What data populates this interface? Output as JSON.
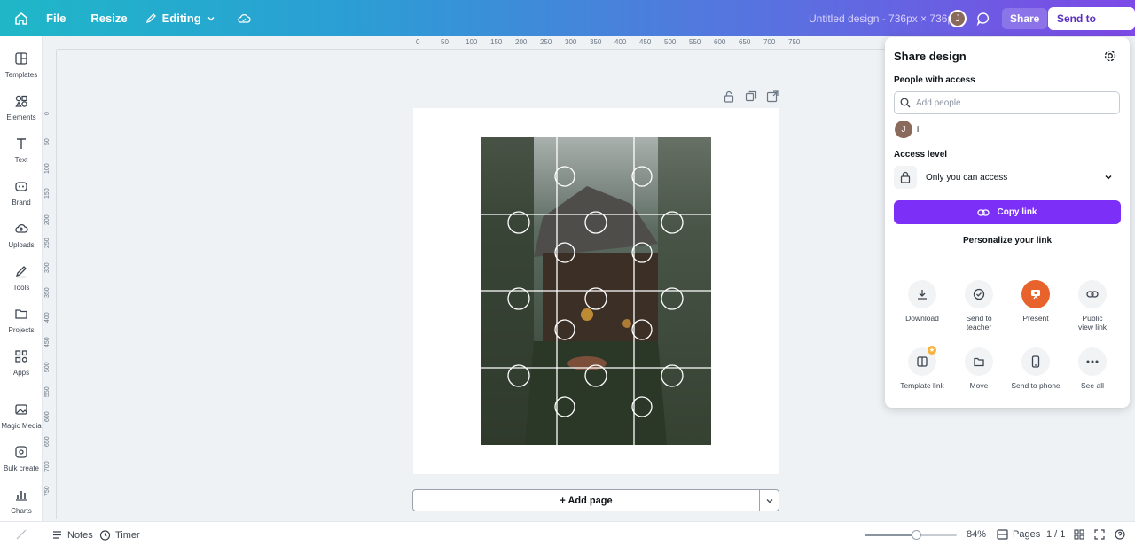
{
  "topbar": {
    "file": "File",
    "resize": "Resize",
    "editing": "Editing",
    "title": "Untitled design - 736px × 736px",
    "avatar": "J",
    "share": "Share",
    "send_to_teacher": "Send to teacher"
  },
  "sidebar": {
    "items": [
      {
        "label": "Templates",
        "icon": "templates-icon"
      },
      {
        "label": "Elements",
        "icon": "elements-icon"
      },
      {
        "label": "Text",
        "icon": "text-icon"
      },
      {
        "label": "Brand",
        "icon": "brand-icon"
      },
      {
        "label": "Uploads",
        "icon": "uploads-icon"
      },
      {
        "label": "Tools",
        "icon": "tools-icon"
      },
      {
        "label": "Projects",
        "icon": "projects-icon"
      },
      {
        "label": "Apps",
        "icon": "apps-icon"
      },
      {
        "label": "Magic Media",
        "icon": "magic-media-icon"
      },
      {
        "label": "Bulk create",
        "icon": "bulk-create-icon"
      },
      {
        "label": "Charts",
        "icon": "charts-icon"
      }
    ]
  },
  "ruler": {
    "horizontal": [
      "0",
      "50",
      "100",
      "150",
      "200",
      "250",
      "300",
      "350",
      "400",
      "450",
      "500",
      "550",
      "600",
      "650",
      "700",
      "750"
    ],
    "vertical": [
      "0",
      "50",
      "100",
      "150",
      "200",
      "250",
      "300",
      "350",
      "400",
      "450",
      "500",
      "550",
      "600",
      "650",
      "700",
      "750"
    ]
  },
  "canvas": {
    "add_page": "+ Add page"
  },
  "bottombar": {
    "notes": "Notes",
    "timer": "Timer",
    "zoom": "84%",
    "zoom_level": 0.84,
    "pages": "Pages",
    "page_count": "1 / 1"
  },
  "share_panel": {
    "title": "Share design",
    "people_label": "People with access",
    "add_people_placeholder": "Add people",
    "avatar": "J",
    "access_label": "Access level",
    "access_value": "Only you can access",
    "copy_link": "Copy link",
    "personalize": "Personalize your link",
    "options": [
      {
        "label": "Download",
        "icon": "download-icon"
      },
      {
        "label": "Send to teacher",
        "icon": "check-circle-icon"
      },
      {
        "label": "Present",
        "icon": "present-icon"
      },
      {
        "label": "Public view link",
        "icon": "link-icon"
      },
      {
        "label": "Template link",
        "icon": "template-link-icon"
      },
      {
        "label": "Move",
        "icon": "folder-icon"
      },
      {
        "label": "Send to phone",
        "icon": "phone-icon"
      },
      {
        "label": "See all",
        "icon": "more-icon"
      }
    ]
  },
  "colors": {
    "accent": "#7b2ff7",
    "present": "#e8622c"
  }
}
